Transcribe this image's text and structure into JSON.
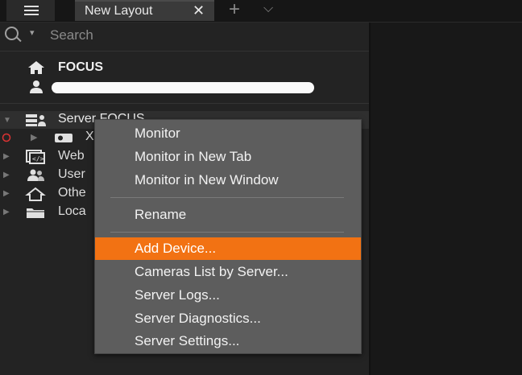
{
  "tabbar": {
    "tab_label": "New Layout",
    "close_glyph": "✕",
    "add_glyph": "+",
    "chevron_glyph": "⌵"
  },
  "search": {
    "placeholder": "Search",
    "dropdown_glyph": "▾"
  },
  "site": {
    "name": "FOCUS",
    "icon": "home-icon"
  },
  "user": {
    "icon": "user-icon",
    "name_redacted": true
  },
  "tree": [
    {
      "label": "Server FOCUS",
      "icon": "server-icon"
    },
    {
      "label": "X",
      "icon": "camera-icon",
      "status": "offline"
    },
    {
      "label": "Web",
      "icon": "web-page-icon"
    },
    {
      "label": "User",
      "icon": "users-icon"
    },
    {
      "label": "Othe",
      "icon": "home-outline-icon"
    },
    {
      "label": "Loca",
      "icon": "folder-icon"
    }
  ],
  "context_menu": {
    "items": [
      "Monitor",
      "Monitor in New Tab",
      "Monitor in New Window",
      "Rename",
      "Add Device...",
      "Cameras List by Server...",
      "Server Logs...",
      "Server Diagnostics...",
      "Server Settings..."
    ],
    "highlighted": "Add Device...",
    "highlight_color": "#f27213"
  }
}
